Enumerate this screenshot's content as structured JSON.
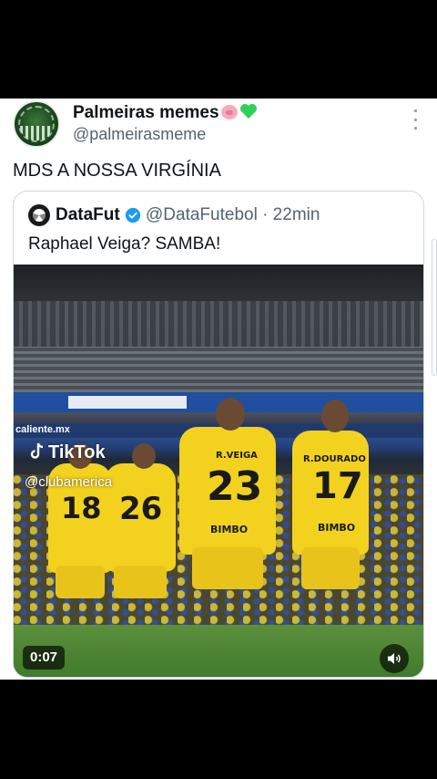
{
  "post": {
    "author_name": "Palmeiras memes",
    "author_emojis": [
      "pig-face",
      "green-heart"
    ],
    "author_handle": "@palmeirasmeme",
    "text": "MDS A NOSSA VIRGÍNIA"
  },
  "quoted_post": {
    "author_name": "DataFut",
    "author_handle": "@DataFutebol · 22min",
    "text": "Raphael Veiga? SAMBA!",
    "verified_color": "#1d9bf0",
    "media": {
      "type": "video",
      "duration": "0:07",
      "watermark": "TikTok",
      "watermark_handle": "@clubamerica",
      "banner_text": "caliente.mx",
      "jersey_numbers": [
        "18",
        "26",
        "23",
        "17"
      ],
      "jersey_names": [
        "R.VEIGA",
        "R.DOURADO"
      ],
      "sponsor": "BIMBO"
    }
  },
  "colors": {
    "text_primary": "#0f1419",
    "text_secondary": "#536471",
    "border": "#cfd9de",
    "jersey_yellow": "#f2d21f"
  }
}
